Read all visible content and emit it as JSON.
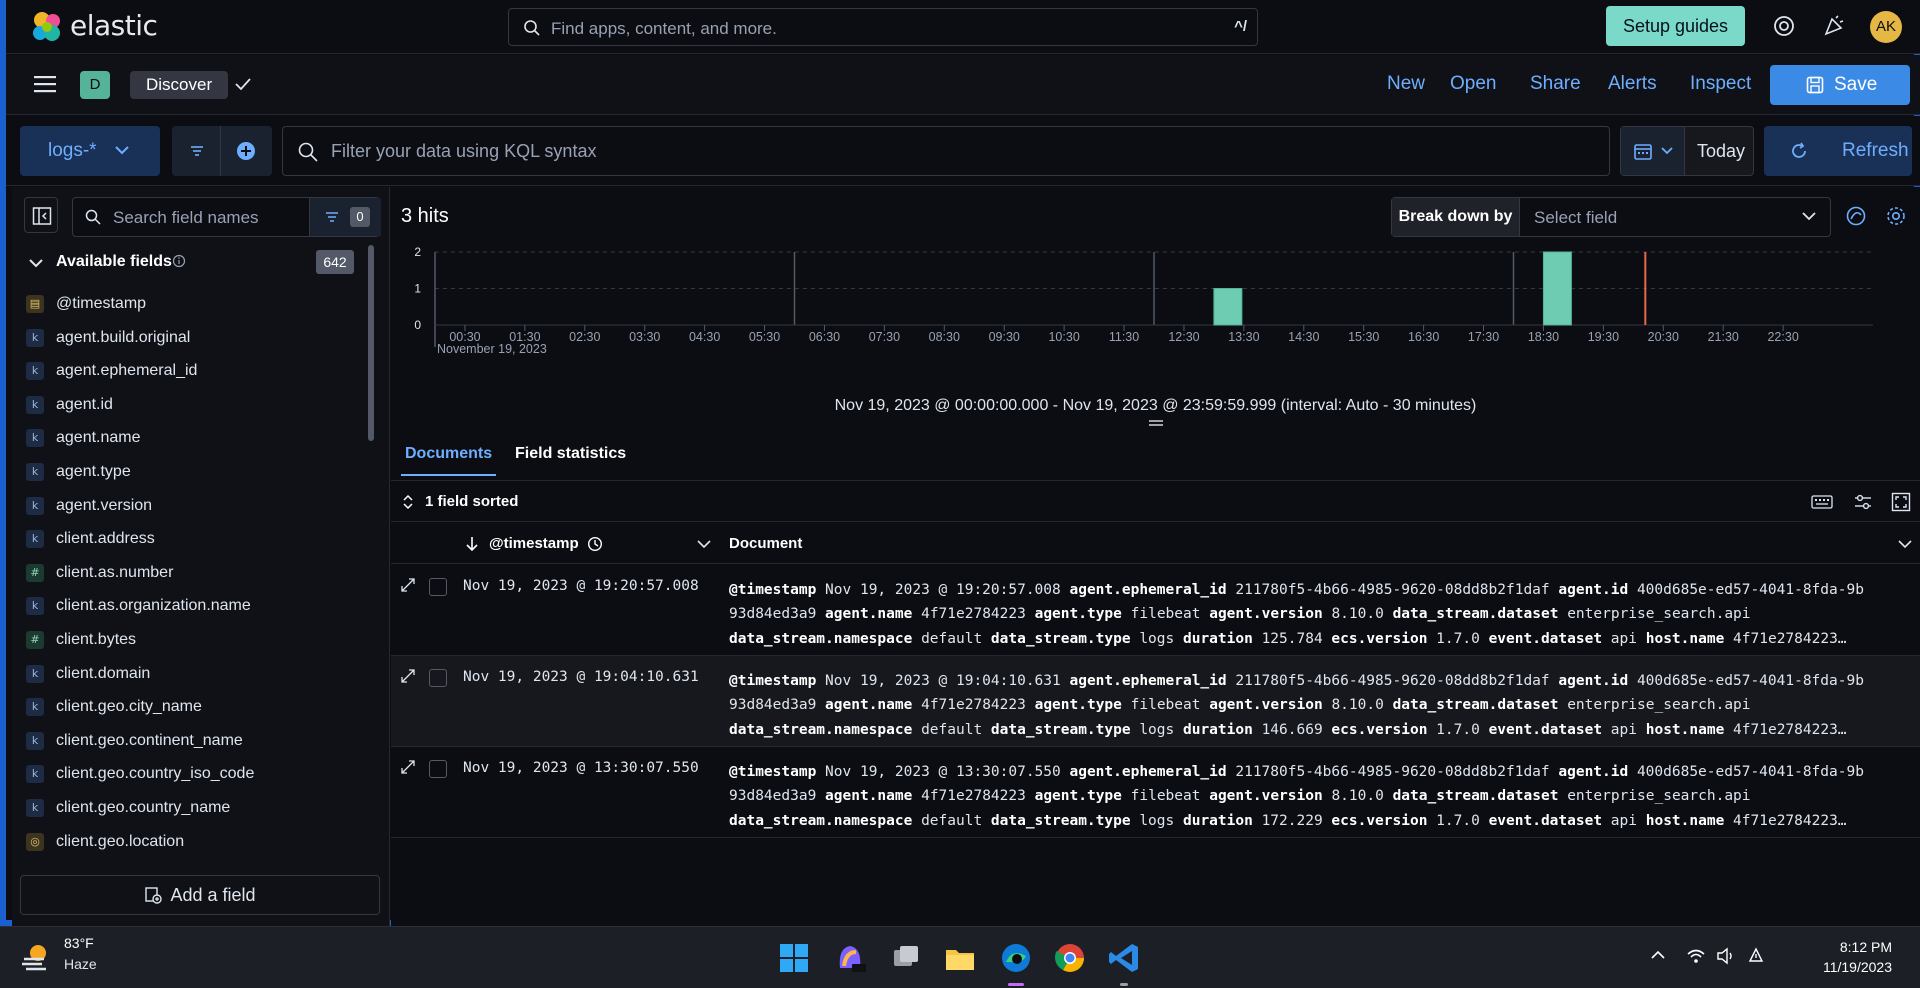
{
  "brand": "elastic",
  "global_search": {
    "placeholder": "Find apps, content, and more.",
    "shortcut": "^/"
  },
  "header": {
    "setup_label": "Setup guides",
    "avatar_initials": "AK"
  },
  "nav": {
    "space_letter": "D",
    "breadcrumb": "Discover",
    "links": [
      "New",
      "Open",
      "Share",
      "Alerts",
      "Inspect"
    ],
    "save_label": "Save"
  },
  "query": {
    "data_view": "logs-*",
    "kql_placeholder": "Filter your data using KQL syntax",
    "date_label": "Today",
    "refresh_label": "Refresh"
  },
  "sidebar": {
    "search_placeholder": "Search field names",
    "filter_count": "0",
    "available_label": "Available fields",
    "available_count": "642",
    "fields": [
      {
        "type": "d",
        "glyph": "▤",
        "name": "@timestamp"
      },
      {
        "type": "k",
        "glyph": "k",
        "name": "agent.build.original"
      },
      {
        "type": "k",
        "glyph": "k",
        "name": "agent.ephemeral_id"
      },
      {
        "type": "k",
        "glyph": "k",
        "name": "agent.id"
      },
      {
        "type": "k",
        "glyph": "k",
        "name": "agent.name"
      },
      {
        "type": "k",
        "glyph": "k",
        "name": "agent.type"
      },
      {
        "type": "k",
        "glyph": "k",
        "name": "agent.version"
      },
      {
        "type": "k",
        "glyph": "k",
        "name": "client.address"
      },
      {
        "type": "n",
        "glyph": "#",
        "name": "client.as.number"
      },
      {
        "type": "k",
        "glyph": "k",
        "name": "client.as.organization.name"
      },
      {
        "type": "n",
        "glyph": "#",
        "name": "client.bytes"
      },
      {
        "type": "k",
        "glyph": "k",
        "name": "client.domain"
      },
      {
        "type": "k",
        "glyph": "k",
        "name": "client.geo.city_name"
      },
      {
        "type": "k",
        "glyph": "k",
        "name": "client.geo.continent_name"
      },
      {
        "type": "k",
        "glyph": "k",
        "name": "client.geo.country_iso_code"
      },
      {
        "type": "k",
        "glyph": "k",
        "name": "client.geo.country_name"
      },
      {
        "type": "g",
        "glyph": "◎",
        "name": "client.geo.location"
      }
    ],
    "add_field_label": "Add a field"
  },
  "main": {
    "hits_label": "3 hits",
    "breakdown_label": "Break down by",
    "breakdown_placeholder": "Select field",
    "interval_text": "Nov 19, 2023 @ 00:00:00.000 - Nov 19, 2023 @ 23:59:59.999 (interval: Auto - 30 minutes)",
    "tabs": [
      "Documents",
      "Field statistics"
    ],
    "sorted_label": "1 field sorted",
    "col_timestamp": "@timestamp",
    "col_document": "Document"
  },
  "chart_data": {
    "type": "bar",
    "date_label": "November 19, 2023",
    "ylim": [
      0,
      2
    ],
    "y_ticks": [
      "0",
      "1",
      "2"
    ],
    "x_ticks": [
      "00:30",
      "01:30",
      "02:30",
      "03:30",
      "04:30",
      "05:30",
      "06:30",
      "07:30",
      "08:30",
      "09:30",
      "10:30",
      "11:30",
      "12:30",
      "13:30",
      "14:30",
      "15:30",
      "16:30",
      "17:30",
      "18:30",
      "19:30",
      "20:30",
      "21:30",
      "22:30"
    ],
    "bars": [
      {
        "hour": 13.0,
        "value": 1
      },
      {
        "hour": 18.5,
        "value": 2
      }
    ],
    "now_marker_hour": 20.2,
    "bar_color": "#6dccb1"
  },
  "rows": [
    {
      "timestamp": "Nov 19, 2023 @ 19:20:57.008",
      "line1": [
        [
          "@timestamp",
          "Nov 19, 2023 @ 19:20:57.008"
        ],
        [
          "agent.ephemeral_id",
          "211780f5-4b66-4985-9620-08dd8b2f1daf"
        ],
        [
          "agent.id",
          "400d685e-ed57-4041-8fda-9b"
        ]
      ],
      "line2": [
        [
          "",
          "93d84ed3a9"
        ],
        [
          "agent.name",
          "4f71e2784223"
        ],
        [
          "agent.type",
          "filebeat"
        ],
        [
          "agent.version",
          "8.10.0"
        ],
        [
          "data_stream.dataset",
          "enterprise_search.api"
        ]
      ],
      "line3": [
        [
          "data_stream.namespace",
          "default"
        ],
        [
          "data_stream.type",
          "logs"
        ],
        [
          "duration",
          "125.784"
        ],
        [
          "ecs.version",
          "1.7.0"
        ],
        [
          "event.dataset",
          "api"
        ],
        [
          "host.name",
          "4f71e2784223…"
        ]
      ]
    },
    {
      "timestamp": "Nov 19, 2023 @ 19:04:10.631",
      "line1": [
        [
          "@timestamp",
          "Nov 19, 2023 @ 19:04:10.631"
        ],
        [
          "agent.ephemeral_id",
          "211780f5-4b66-4985-9620-08dd8b2f1daf"
        ],
        [
          "agent.id",
          "400d685e-ed57-4041-8fda-9b"
        ]
      ],
      "line2": [
        [
          "",
          "93d84ed3a9"
        ],
        [
          "agent.name",
          "4f71e2784223"
        ],
        [
          "agent.type",
          "filebeat"
        ],
        [
          "agent.version",
          "8.10.0"
        ],
        [
          "data_stream.dataset",
          "enterprise_search.api"
        ]
      ],
      "line3": [
        [
          "data_stream.namespace",
          "default"
        ],
        [
          "data_stream.type",
          "logs"
        ],
        [
          "duration",
          "146.669"
        ],
        [
          "ecs.version",
          "1.7.0"
        ],
        [
          "event.dataset",
          "api"
        ],
        [
          "host.name",
          "4f71e2784223…"
        ]
      ]
    },
    {
      "timestamp": "Nov 19, 2023 @ 13:30:07.550",
      "line1": [
        [
          "@timestamp",
          "Nov 19, 2023 @ 13:30:07.550"
        ],
        [
          "agent.ephemeral_id",
          "211780f5-4b66-4985-9620-08dd8b2f1daf"
        ],
        [
          "agent.id",
          "400d685e-ed57-4041-8fda-9b"
        ]
      ],
      "line2": [
        [
          "",
          "93d84ed3a9"
        ],
        [
          "agent.name",
          "4f71e2784223"
        ],
        [
          "agent.type",
          "filebeat"
        ],
        [
          "agent.version",
          "8.10.0"
        ],
        [
          "data_stream.dataset",
          "enterprise_search.api"
        ]
      ],
      "line3": [
        [
          "data_stream.namespace",
          "default"
        ],
        [
          "data_stream.type",
          "logs"
        ],
        [
          "duration",
          "172.229"
        ],
        [
          "ecs.version",
          "1.7.0"
        ],
        [
          "event.dataset",
          "api"
        ],
        [
          "host.name",
          "4f71e2784223…"
        ]
      ]
    }
  ],
  "taskbar": {
    "temp": "83°F",
    "condition": "Haze",
    "time": "8:12 PM",
    "date": "11/19/2023"
  }
}
